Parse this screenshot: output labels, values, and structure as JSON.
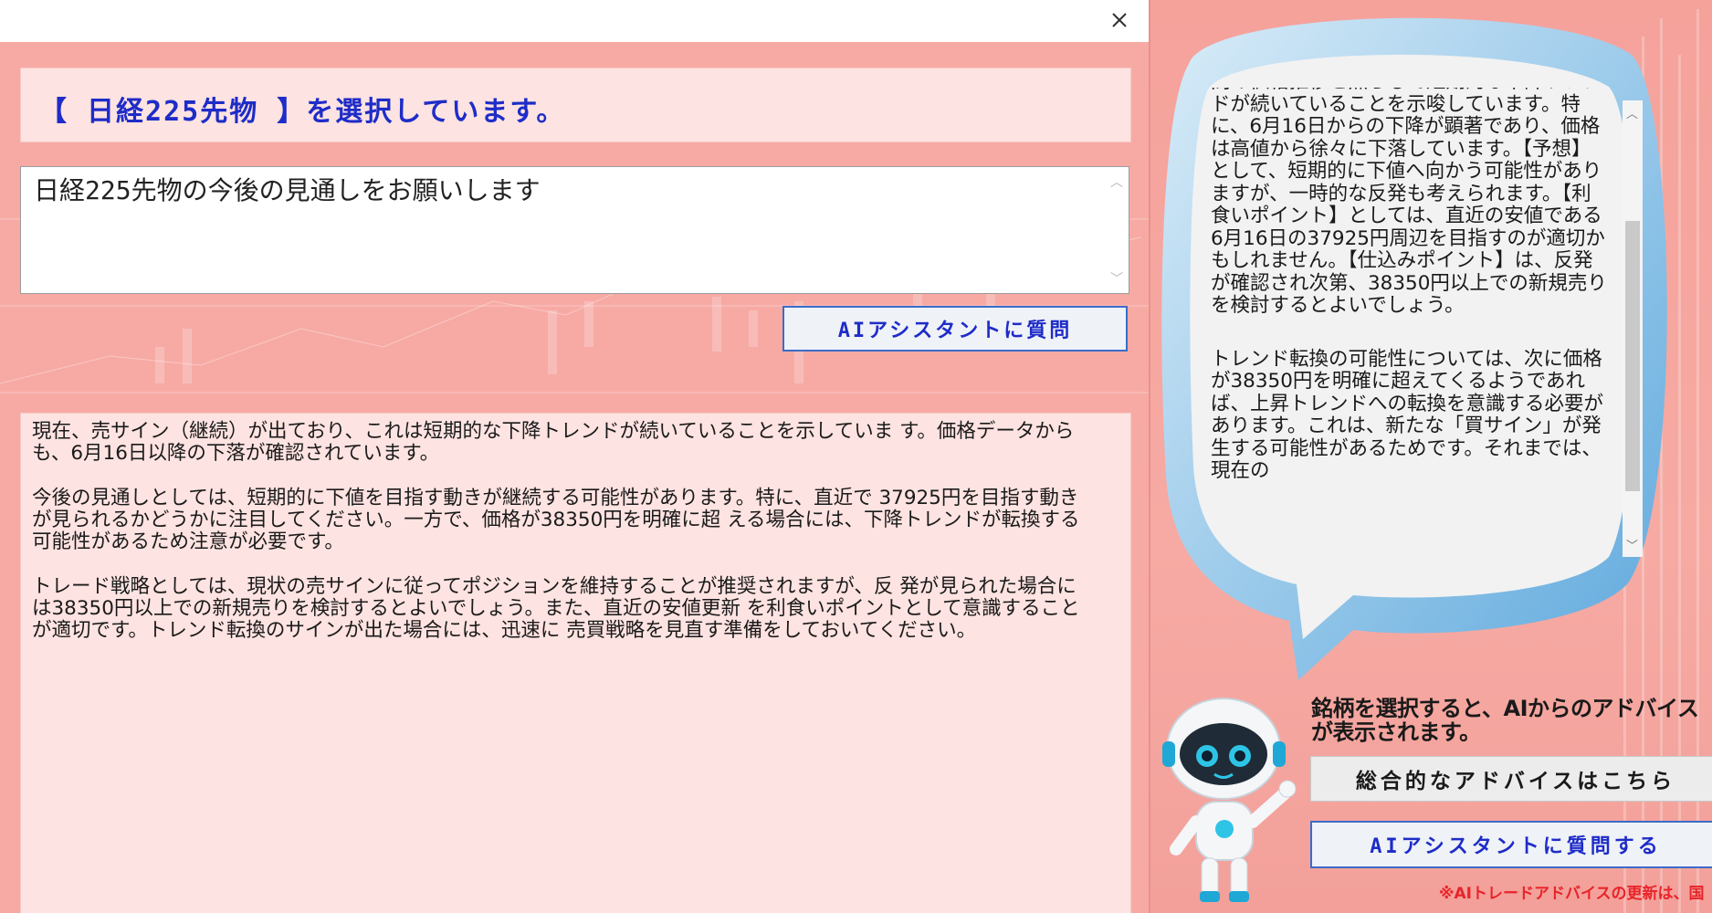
{
  "dialog": {
    "close_icon": "close-icon",
    "heading": "【 日経225先物 】を選択しています。",
    "question": "日経225先物の今後の見通しをお願いします",
    "ask_button_label": "AIアシスタントに質問",
    "answer_paragraphs": [
      "現在、売サイン（継続）が出ており、これは短期的な下降トレンドが続いていることを示していま す。価格データからも、6月16日以降の下落が確認されています。",
      "今後の見通しとしては、短期的に下値を目指す動きが継続する可能性があります。特に、直近で 37925円を目指す動きが見られるかどうかに注目してください。一方で、価格が38350円を明確に超 える場合には、下降トレンドが転換する可能性があるため注意が必要です。",
      "トレード戦略としては、現状の売サインに従ってポジションを維持することが推奨されますが、反 発が見られた場合には38350円以上での新規売りを検討するとよいでしょう。また、直近の安値更新 を利食いポイントとして意識することが適切です。トレンド転換のサインが出た場合には、迅速に 売買戦略を見直す準備をしておいてください。"
    ]
  },
  "bubble": {
    "paragraphs": [
      "間の価格推移と照らして短期的な下降トレンドが続いていることを示唆しています。特に、6月16日からの下降が顕著であり、価格は高値から徐々に下落しています。【予想】として、短期的に下値へ向かう可能性がありますが、一時的な反発も考えられます。【利食いポイント】としては、直近の安値である6月16日の37925円周辺を目指すのが適切かもしれません。【仕込みポイント】は、反発が確認され次第、38350円以上での新規売りを検討するとよいでしょう。",
      "トレンド転換の可能性については、次に価格が38350円を明確に超えてくるようであれば、上昇トレンドへの転換を意識する必要があります。これは、新たな「買サイン」が発生する可能性があるためです。それまでは、現在の"
    ]
  },
  "sidebar": {
    "advice_text": "銘柄を選択すると、AIからのアドバイスが表示されます。",
    "overall_button_label": "総合的なアドバイスはこちら",
    "assistant_button_label": "AIアシスタントに質問する",
    "footnote": "※AIトレードアドバイスの更新は、国"
  }
}
